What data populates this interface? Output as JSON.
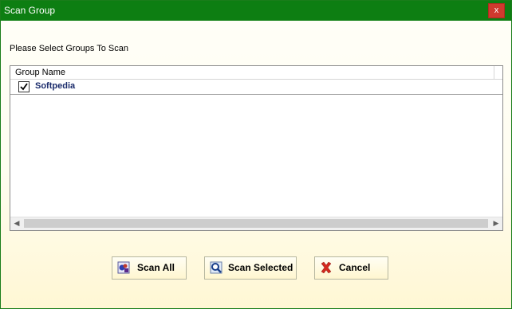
{
  "window": {
    "title": "Scan Group",
    "close_label": "x"
  },
  "prompt": "Please Select Groups To Scan",
  "groups_list": {
    "column_header": "Group Name",
    "rows": [
      {
        "label": "Softpedia",
        "checked": true
      }
    ]
  },
  "buttons": {
    "scan_all": "Scan All",
    "scan_selected": "Scan Selected",
    "cancel": "Cancel"
  },
  "colors": {
    "titlebar": "#0d7e12",
    "close_button": "#cf3a2e",
    "row_label": "#1a2b6b"
  }
}
